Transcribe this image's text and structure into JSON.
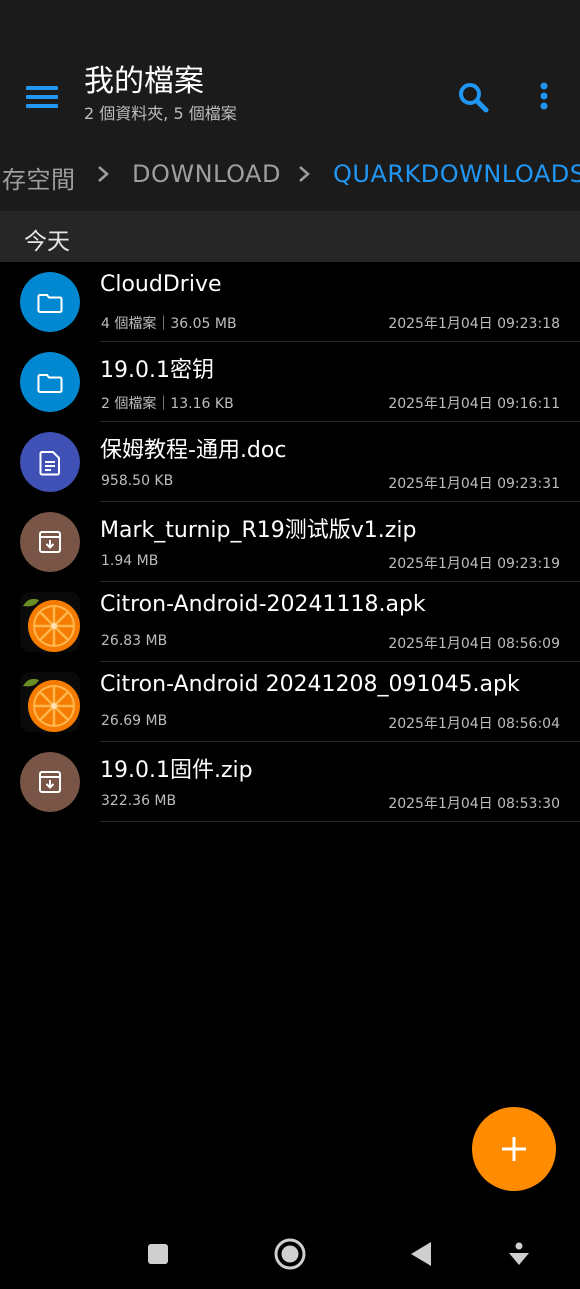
{
  "header": {
    "title": "我的檔案",
    "subtitle": "2 個資料夾, 5 個檔案",
    "icons": {
      "menu": "menu-icon",
      "search": "search-icon",
      "more": "more-vert-icon"
    },
    "accent_color": "#2196f3"
  },
  "breadcrumb": {
    "items": [
      {
        "label": "存空間"
      },
      {
        "label": "DOWNLOAD"
      },
      {
        "label": "QUARKDOWNLOADS"
      }
    ],
    "separator_icon": "chevron-right-icon"
  },
  "section": {
    "label": "今天"
  },
  "files": [
    {
      "name": "CloudDrive",
      "meta": "4 個檔案｜36.05 MB",
      "date": "2025年1月04日 09:23:18",
      "icon": "folder-icon",
      "color": "#0288d1"
    },
    {
      "name": "19.0.1密钥",
      "meta": "2 個檔案｜13.16 KB",
      "date": "2025年1月04日 09:16:11",
      "icon": "folder-icon",
      "color": "#0288d1"
    },
    {
      "name": "保姆教程-通用.doc",
      "meta": "958.50 KB",
      "date": "2025年1月04日 09:23:31",
      "icon": "document-icon",
      "color": "#3f51b5"
    },
    {
      "name": "Mark_turnip_R19测试版v1.zip",
      "meta": "1.94 MB",
      "date": "2025年1月04日 09:23:19",
      "icon": "archive-icon",
      "color": "#795548"
    },
    {
      "name": "Citron-Android-20241118.apk",
      "meta": "26.83 MB",
      "date": "2025年1月04日 08:56:09",
      "icon": "citron-app-icon",
      "color": "#f57c00"
    },
    {
      "name": "Citron-Android 20241208_091045.apk",
      "meta": "26.69 MB",
      "date": "2025年1月04日 08:56:04",
      "icon": "citron-app-icon",
      "color": "#f57c00"
    },
    {
      "name": "19.0.1固件.zip",
      "meta": "322.36 MB",
      "date": "2025年1月04日 08:53:30",
      "icon": "archive-icon",
      "color": "#795548"
    }
  ],
  "fab": {
    "icon": "plus-icon",
    "color": "#ff8c00"
  },
  "navbar": {
    "icons": [
      "recents-square-icon",
      "home-circle-icon",
      "back-triangle-icon",
      "assistant-icon"
    ]
  }
}
